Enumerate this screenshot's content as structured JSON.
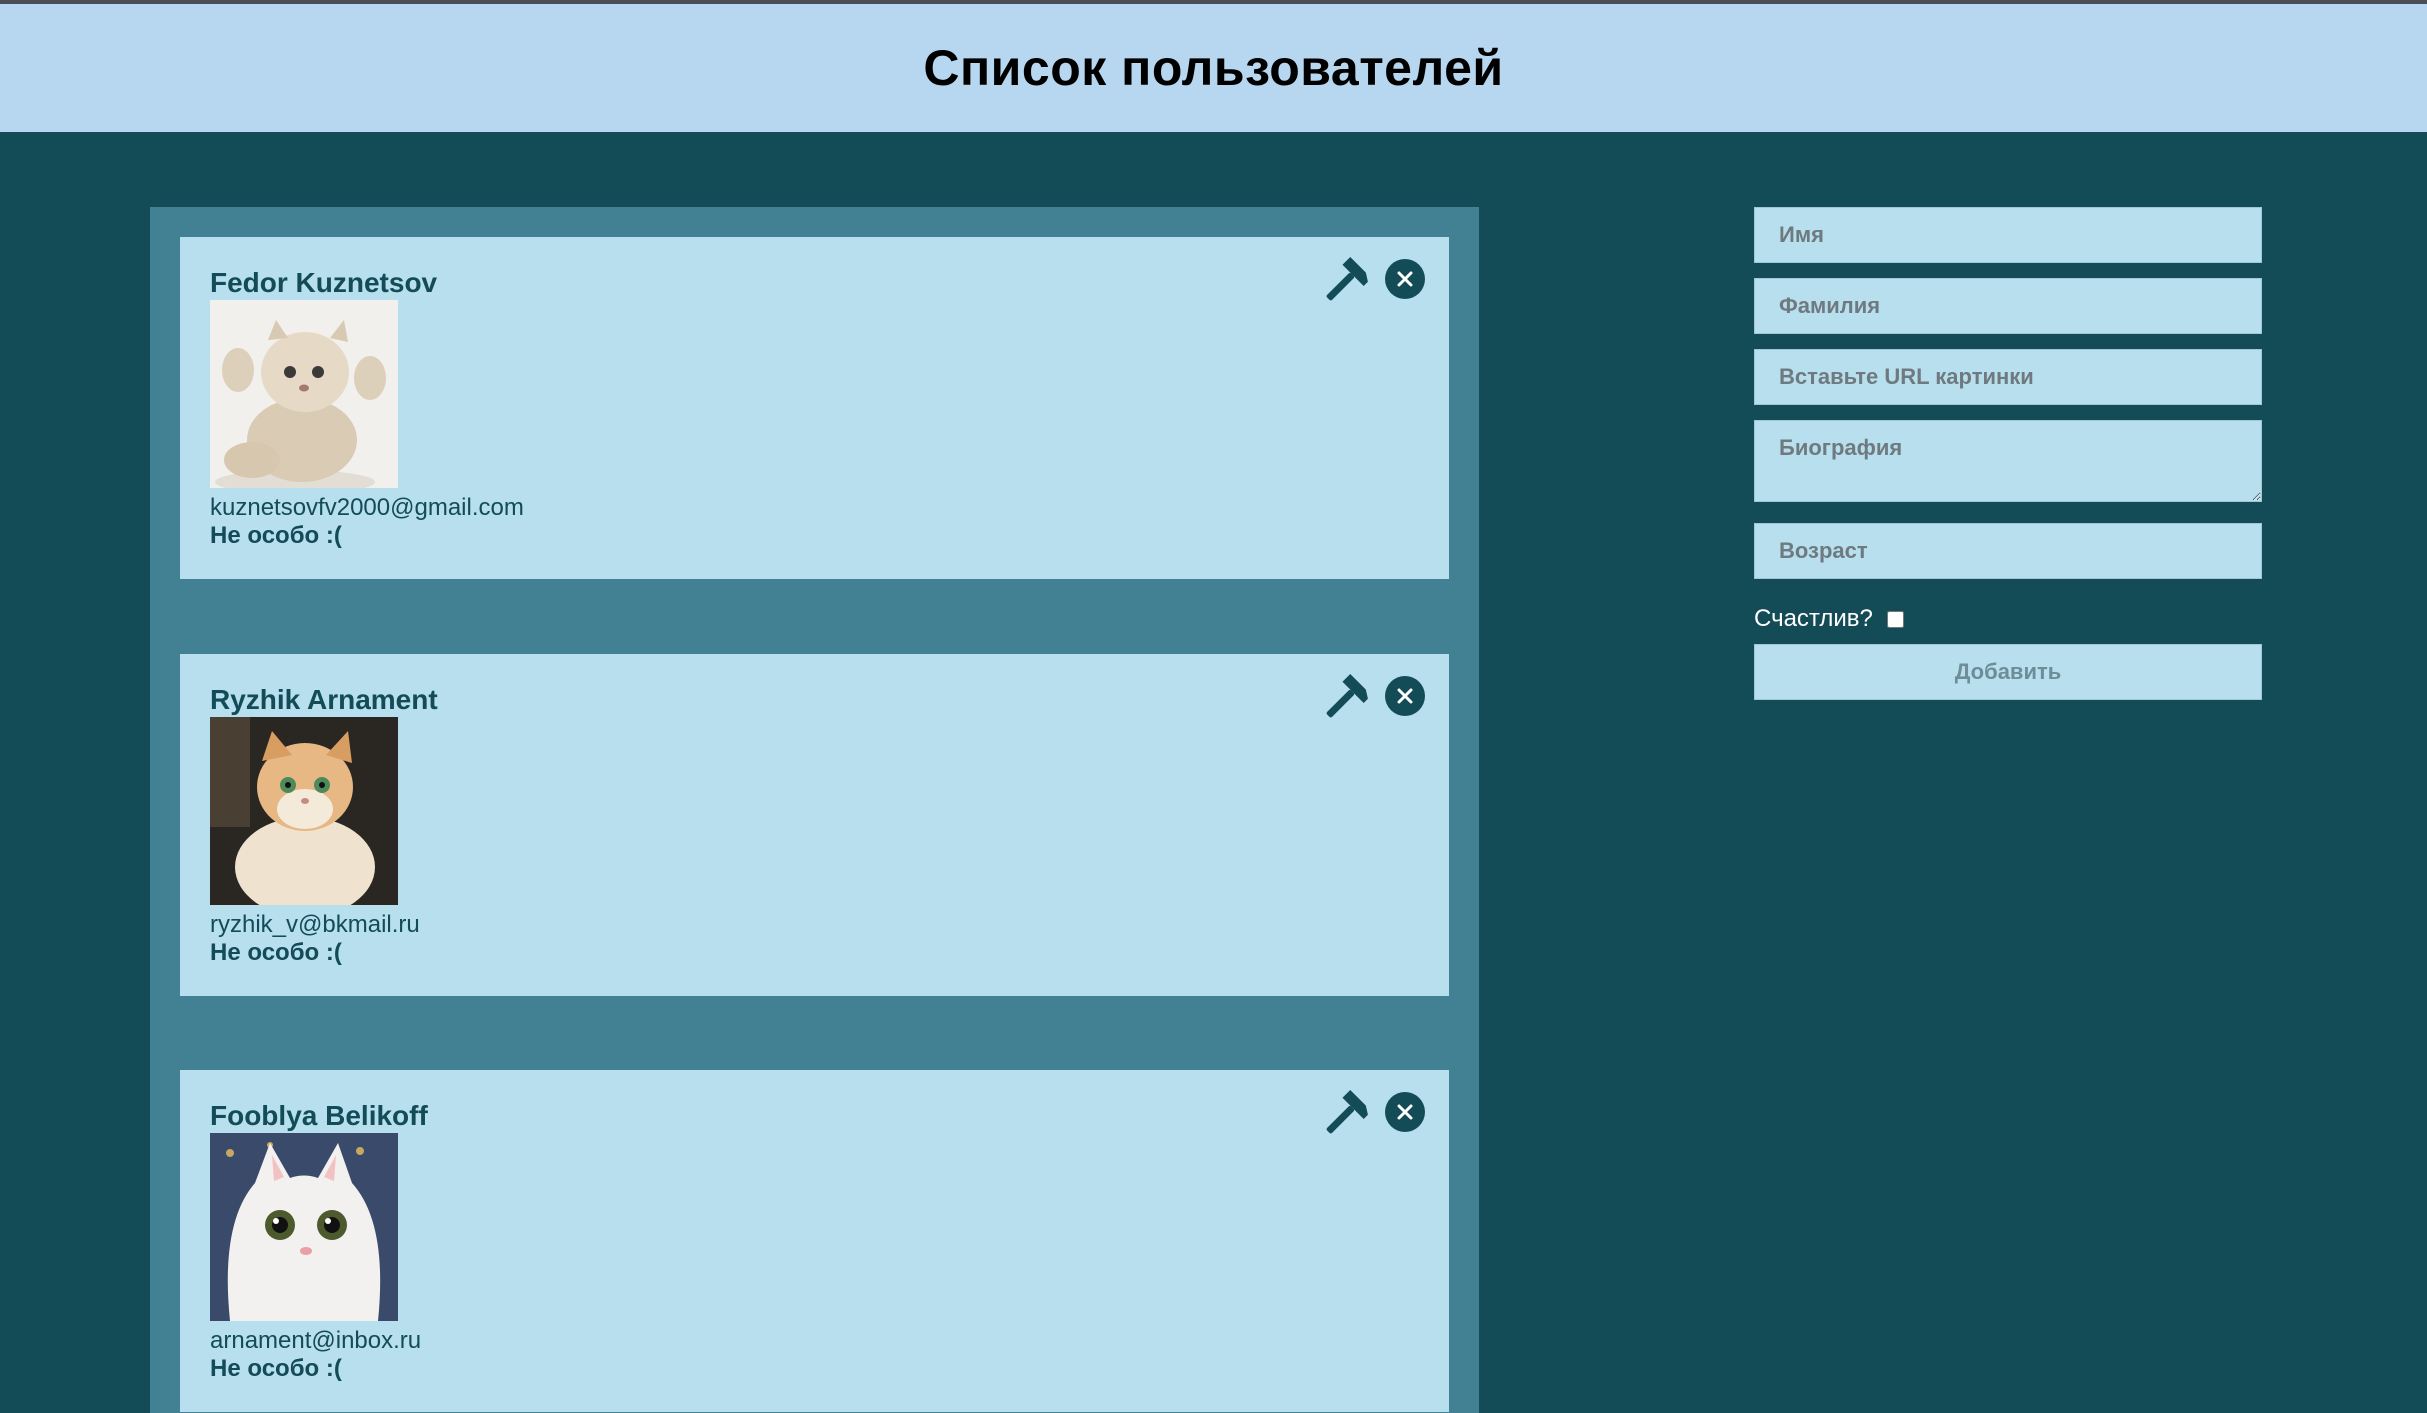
{
  "page": {
    "title": "Список пользователей"
  },
  "users": [
    {
      "name": "Fedor Kuznetsov",
      "email": "kuznetsovfv2000@gmail.com",
      "happy": "Не особо :(",
      "photo": "cat-hands-up"
    },
    {
      "name": "Ryzhik Arnament",
      "email": "ryzhik_v@bkmail.ru",
      "happy": "Не особо :(",
      "photo": "fluffy-ginger-cat"
    },
    {
      "name": "Fooblya Belikoff",
      "email": "arnament@inbox.ru",
      "happy": "Не особо :(",
      "photo": "white-cat-face"
    }
  ],
  "card_actions": {
    "edit_icon": "hammer-icon",
    "delete_icon": "close-circle-icon"
  },
  "form": {
    "first_name_placeholder": "Имя",
    "last_name_placeholder": "Фамилия",
    "image_url_placeholder": "Вставьте URL картинки",
    "bio_placeholder": "Биография",
    "age_placeholder": "Возраст",
    "happy_label": "Счастлив?",
    "submit_label": "Добавить"
  },
  "colors": {
    "background": "#134b57",
    "header": "#b7d6ef",
    "list_panel": "#428193",
    "card": "#b7dfee",
    "text_dark": "#134b57"
  }
}
